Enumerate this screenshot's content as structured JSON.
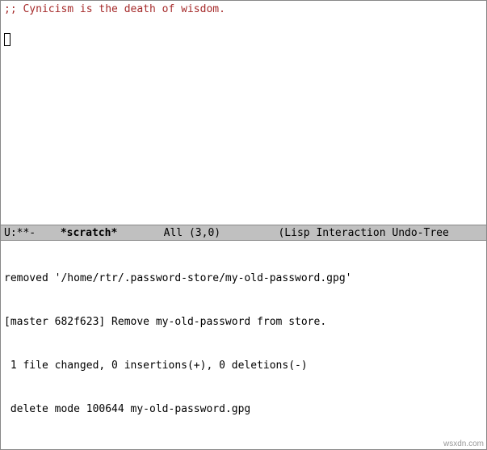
{
  "buffer": {
    "comment": ";; Cynicism is the death of wisdom."
  },
  "modeline": {
    "state": "U:**-",
    "buffer_name": "*scratch*",
    "position": "All (3,0)",
    "modes": "(Lisp Interaction Undo-Tree"
  },
  "minibuffer": {
    "line1": "removed '/home/rtr/.password-store/my-old-password.gpg'",
    "line2": "[master 682f623] Remove my-old-password from store.",
    "line3": " 1 file changed, 0 insertions(+), 0 deletions(-)",
    "line4": " delete mode 100644 my-old-password.gpg"
  },
  "watermark": "wsxdn.com"
}
